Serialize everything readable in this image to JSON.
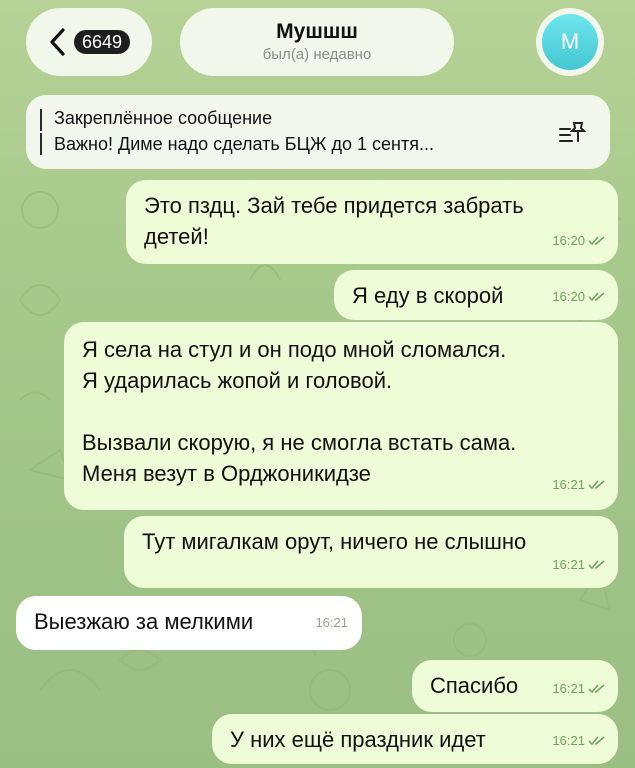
{
  "header": {
    "back_count": "6649",
    "chat_name": "Мушшш",
    "status": "был(а) недавно",
    "avatar_letter": "М",
    "avatar_color": "#4fd0da"
  },
  "pinned": {
    "title": "Закреплённое сообщение",
    "text": "Важно! Диме надо сделать БЦЖ до 1 сентя..."
  },
  "messages": [
    {
      "direction": "out",
      "text": "Это пздц. Зай тебе придется забрать\nдетей!",
      "time": "16:20",
      "read": true
    },
    {
      "direction": "out",
      "text": "Я еду в скорой",
      "time": "16:20",
      "read": true
    },
    {
      "direction": "out",
      "text": "Я села на стул и он подо мной сломался.\nЯ ударилась жопой и головой.\n\nВызвали скорую, я не смогла встать сама.\nМеня везут в Орджоникидзе",
      "time": "16:21",
      "read": true
    },
    {
      "direction": "out",
      "text": "Тут мигалкам орут, ничего не слышно",
      "time": "16:21",
      "read": true
    },
    {
      "direction": "in",
      "text": "Выезжаю за мелкими",
      "time": "16:21"
    },
    {
      "direction": "out",
      "text": "Спасибо",
      "time": "16:21",
      "read": true
    },
    {
      "direction": "out",
      "text": "У них ещё праздник идет",
      "time": "16:21",
      "read": true
    }
  ]
}
